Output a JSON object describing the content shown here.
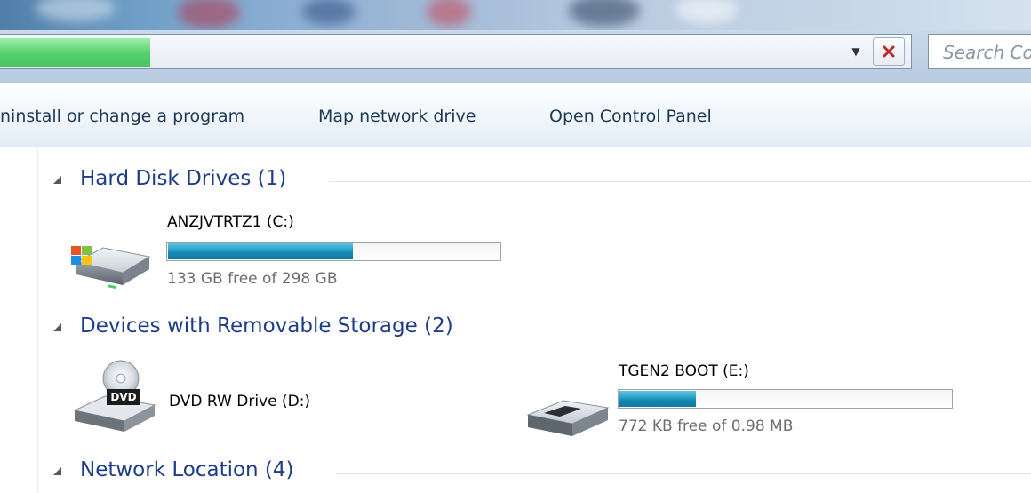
{
  "address_bar": {
    "path": "",
    "search_placeholder": "Search Co",
    "progress": 0.165
  },
  "toolbar": {
    "items": [
      "ninstall or change a program",
      "Map network drive",
      "Open Control Panel"
    ]
  },
  "groups": {
    "hard_disk": {
      "title": "Hard Disk Drives (1)",
      "drives": [
        {
          "name": "ANZJVTRTZ1 (C:)",
          "free_text": "133 GB free of 298 GB",
          "used_fraction": 0.554,
          "icon": "windows-hard-disk-icon"
        }
      ]
    },
    "removable": {
      "title": "Devices with Removable Storage (2)",
      "drives": [
        {
          "name": "DVD RW Drive (D:)",
          "icon": "dvd-drive-icon",
          "dvd_label": "DVD"
        },
        {
          "name": "TGEN2 BOOT (E:)",
          "free_text": "772 KB free of 0.98 MB",
          "used_fraction": 0.23,
          "icon": "usb-drive-icon"
        }
      ]
    },
    "network": {
      "title": "Network Location (4)"
    }
  },
  "colors": {
    "group_title": "#1e3d88",
    "capacity_fill": "#1387b1",
    "progress_green": "#48c660",
    "close_x": "#c0282d"
  }
}
